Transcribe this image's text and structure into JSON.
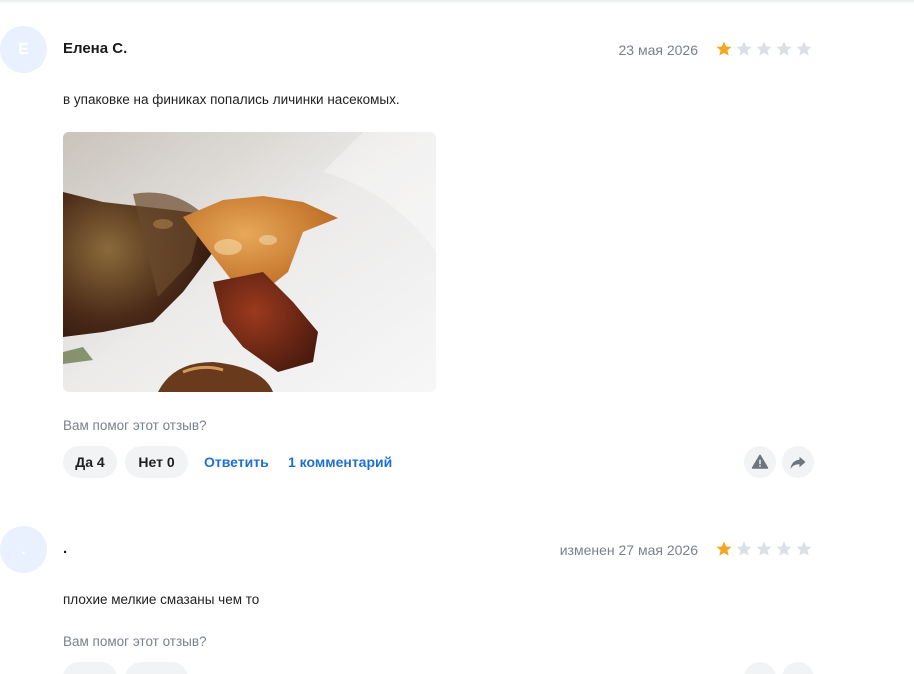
{
  "reviews": [
    {
      "avatar_letter": "Е",
      "author": "Елена С.",
      "date": "23 мая 2026",
      "rating": 1,
      "rating_max": 5,
      "text": "в упаковке на финиках попались личинки насекомых.",
      "has_photo": true,
      "helpful_question": "Вам помог этот отзыв?",
      "yes_label": "Да 4",
      "no_label": "Нет 0",
      "reply_label": "Ответить",
      "comments_label": "1 комментарий"
    },
    {
      "avatar_letter": ".",
      "author": ".",
      "date": "изменен 27 мая 2026",
      "rating": 1,
      "rating_max": 5,
      "text": "плохие мелкие смазаны чем то",
      "has_photo": false,
      "helpful_question": "Вам помог этот отзыв?"
    }
  ],
  "colors": {
    "star_filled": "#f5a623",
    "star_empty": "#dcdfe4",
    "link": "#1f6fd1",
    "muted": "#7b818a",
    "avatar_bg": "#e8f1fd"
  },
  "icons": {
    "report": "warning-triangle-icon",
    "share": "share-arrow-icon",
    "star": "star-icon"
  }
}
